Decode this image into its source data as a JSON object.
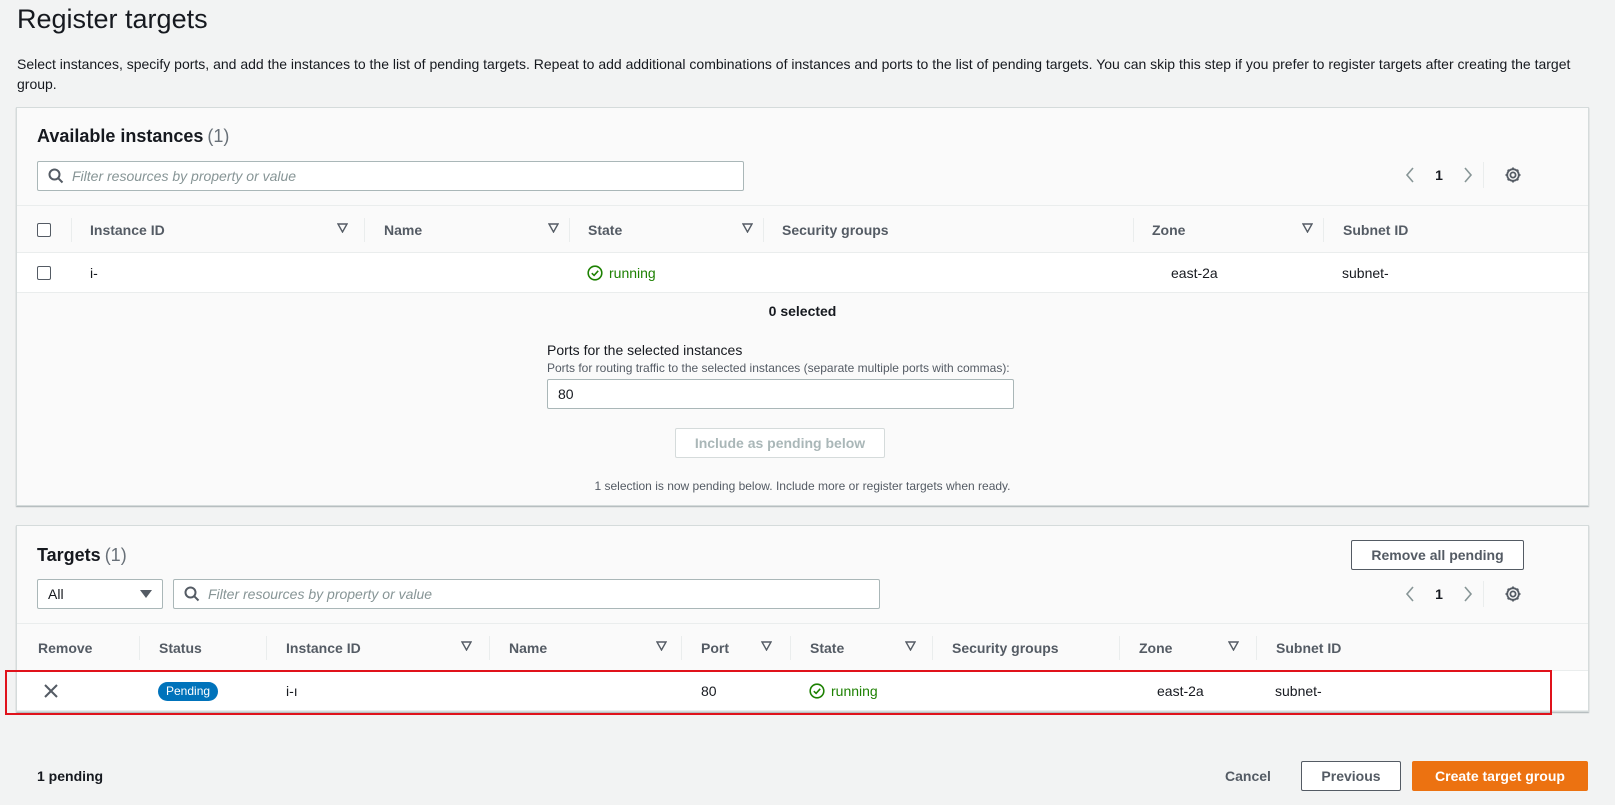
{
  "page": {
    "title": "Register targets",
    "description": "Select instances, specify ports, and add the instances to the list of pending targets. Repeat to add additional combinations of instances and ports to the list of pending targets. You can skip this step if you prefer to register targets after creating the target group."
  },
  "available": {
    "title": "Available instances",
    "count": "(1)",
    "search_placeholder": "Filter resources by property or value",
    "page_number": "1",
    "columns": [
      "Instance ID",
      "Name",
      "State",
      "Security groups",
      "Zone",
      "Subnet ID"
    ],
    "rows": [
      {
        "instance_id": "i-",
        "name": "",
        "state": "running",
        "security_groups": "",
        "zone": "east-2a",
        "subnet_id": "subnet-"
      }
    ],
    "selected_text": "0 selected",
    "ports_label": "Ports for the selected instances",
    "ports_description": "Ports for routing traffic to the selected instances (separate multiple ports with commas):",
    "ports_value": "80",
    "include_button": "Include as pending below",
    "pending_note": "1 selection is now pending below. Include more or register targets when ready."
  },
  "targets": {
    "title": "Targets",
    "count": "(1)",
    "remove_all_button": "Remove all pending",
    "filter_select_value": "All",
    "search_placeholder": "Filter resources by property or value",
    "page_number": "1",
    "columns": [
      "Remove",
      "Status",
      "Instance ID",
      "Name",
      "Port",
      "State",
      "Security groups",
      "Zone",
      "Subnet ID"
    ],
    "rows": [
      {
        "status": "Pending",
        "instance_id": "i-ı",
        "name": "",
        "port": "80",
        "state": "running",
        "security_groups": "",
        "zone": "east-2a",
        "subnet_id": "subnet-"
      }
    ]
  },
  "footer": {
    "pending_count": "1 pending",
    "cancel_button": "Cancel",
    "previous_button": "Previous",
    "create_button": "Create target group"
  },
  "colors": {
    "primary": "#ec7211",
    "running": "#1d8102",
    "pending_badge": "#0073bb",
    "highlight": "#e0121b"
  }
}
